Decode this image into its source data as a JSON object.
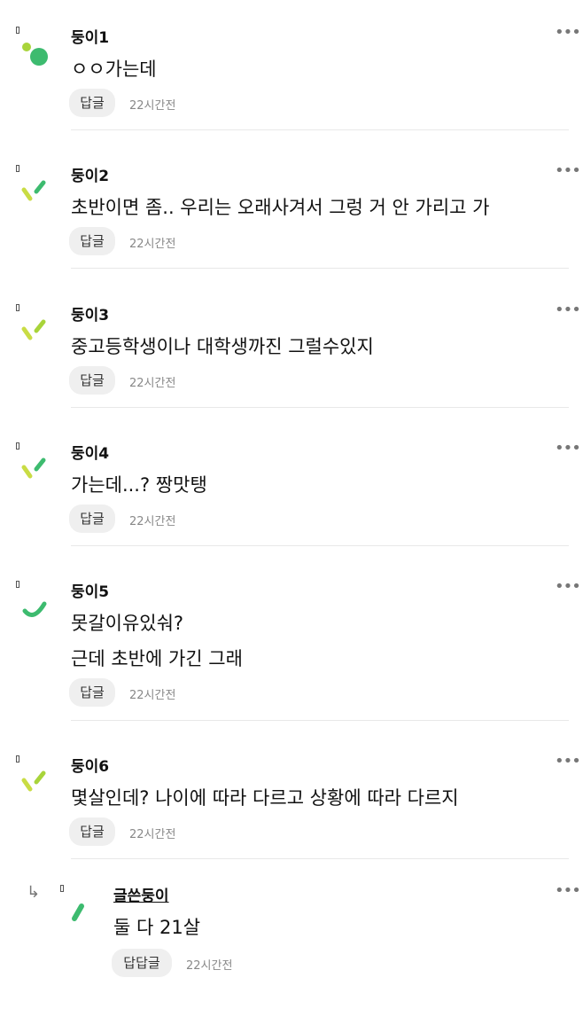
{
  "comments": [
    {
      "name": "둥이1",
      "lines": [
        "ㅇㅇ가는데"
      ],
      "reply_label": "답글",
      "time": "22시간전",
      "avatar": "dots"
    },
    {
      "name": "둥이2",
      "lines": [
        "초반이면 좀.. 우리는 오래사겨서 그렁 거 안 가리고 가"
      ],
      "reply_label": "답글",
      "time": "22시간전",
      "avatar": "check"
    },
    {
      "name": "둥이3",
      "lines": [
        "중고등학생이나 대학생까진 그럴수있지"
      ],
      "reply_label": "답글",
      "time": "22시간전",
      "avatar": "check"
    },
    {
      "name": "둥이4",
      "lines": [
        "가는데...? 짱맛탱"
      ],
      "reply_label": "답글",
      "time": "22시간전",
      "avatar": "check"
    },
    {
      "name": "둥이5",
      "lines": [
        "못갈이유있숴?",
        "근데 초반에 가긴 그래"
      ],
      "reply_label": "답글",
      "time": "22시간전",
      "avatar": "arc"
    },
    {
      "name": "둥이6",
      "lines": [
        "몇살인데? 나이에 따라 다르고 상황에 따라 다르지"
      ],
      "reply_label": "답글",
      "time": "22시간전",
      "avatar": "check"
    }
  ],
  "reply": {
    "name": "글쓴둥이",
    "lines": [
      "둘 다 21살"
    ],
    "reply_label": "답답글",
    "time": "22시간전",
    "avatar": "dash"
  },
  "more_label": "•••",
  "reply_arrow": "↳",
  "colors": {
    "green": "#3dbb6f",
    "lime": "#a8d43a",
    "yellow_green": "#c9dc44"
  }
}
